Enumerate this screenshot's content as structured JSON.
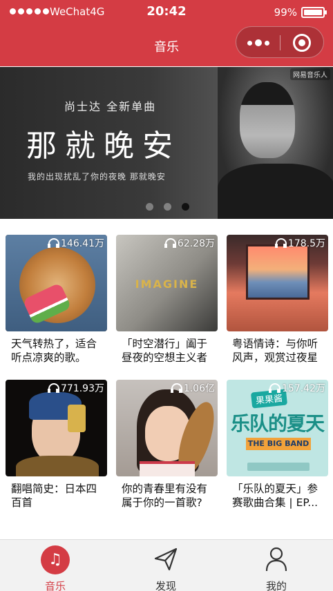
{
  "status_bar": {
    "carrier": "WeChat4G",
    "time": "20:42",
    "battery": "99%",
    "battery_level": 0.99
  },
  "navbar": {
    "title": "音乐",
    "capsule_icons": [
      "more-dots-icon",
      "close-target-icon"
    ]
  },
  "banner": {
    "subtitle": "尚士达 全新单曲",
    "title": "那就晚安",
    "lyric": "我的出现扰乱了你的夜晚 那就晚安",
    "tag": "网易音乐人",
    "active_dot": 3,
    "dot_count": 3
  },
  "playlists": [
    {
      "count": "146.41万",
      "title": "天气转热了，适合听点凉爽的歌。"
    },
    {
      "count": "62.28万",
      "title": "「时空潜行」阖于昼夜的空想主义者",
      "cover_text": "IMAGINE"
    },
    {
      "count": "178.5万",
      "title": "粤语情诗：与你听风声，观赏过夜星"
    },
    {
      "count": "771.93万",
      "title": "翻唱简史：日本四百首"
    },
    {
      "count": "1.06亿",
      "title": "你的青春里有没有属于你的一首歌?"
    },
    {
      "count": "157.42万",
      "title": "「乐队的夏天」参赛歌曲合集 | EP...",
      "cover_text": [
        "果果酱",
        "乐队的夏天",
        "THE BIG BAND"
      ]
    }
  ],
  "tabbar": {
    "items": [
      {
        "label": "音乐",
        "icon": "music-note-icon",
        "active": true
      },
      {
        "label": "发现",
        "icon": "paper-plane-icon",
        "active": false
      },
      {
        "label": "我的",
        "icon": "person-icon",
        "active": false
      }
    ]
  },
  "colors": {
    "primary": "#d43c44",
    "tabbar_bg": "#f2f2f2"
  }
}
